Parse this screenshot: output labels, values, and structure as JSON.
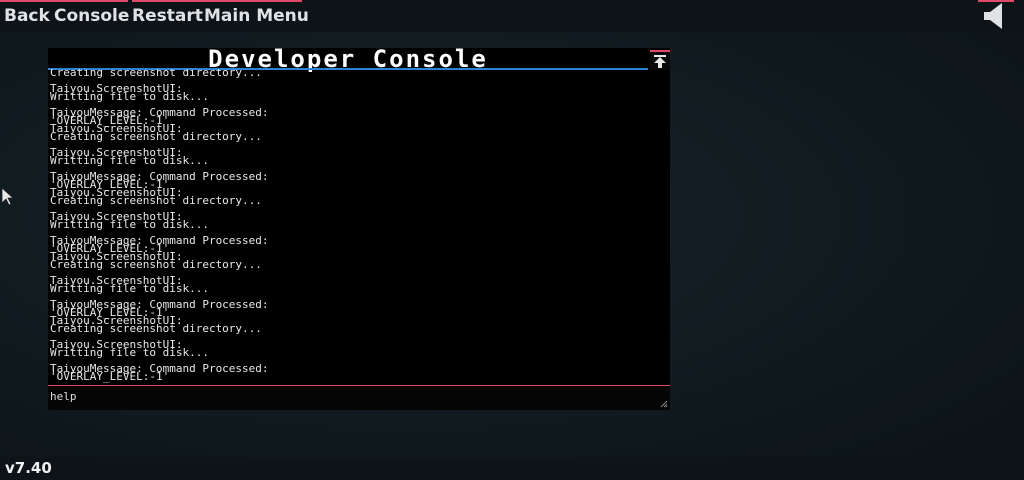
{
  "topbar": {
    "back": "Back",
    "console": "Console",
    "restart": "Restart",
    "main_menu": "Main Menu",
    "audio_icon": "speaker-icon"
  },
  "console": {
    "title": "Developer Console",
    "lines": [
      "Creating screenshot directory...",
      "",
      "Taiyou.ScreenshotUI:",
      "Writting file to disk...",
      "",
      "TaiyouMessage: Command Processed:",
      "'OVERLAY_LEVEL:-1'",
      "Taiyou.ScreenshotUI:",
      "Creating screenshot directory...",
      "",
      "Taiyou.ScreenshotUI:",
      "Writting file to disk...",
      "",
      "TaiyouMessage: Command Processed:",
      "'OVERLAY_LEVEL:-1'",
      "Taiyou.ScreenshotUI:",
      "Creating screenshot directory...",
      "",
      "Taiyou.ScreenshotUI:",
      "Writting file to disk...",
      "",
      "TaiyouMessage: Command Processed:",
      "'OVERLAY_LEVEL:-1'",
      "Taiyou.ScreenshotUI:",
      "Creating screenshot directory...",
      "",
      "Taiyou.ScreenshotUI:",
      "Writting file to disk...",
      "",
      "TaiyouMessage: Command Processed:",
      "'OVERLAY_LEVEL:-1'",
      "Taiyou.ScreenshotUI:",
      "Creating screenshot directory...",
      "",
      "Taiyou.ScreenshotUI:",
      "Writting file to disk...",
      "",
      "TaiyouMessage: Command Processed:",
      "'OVERLAY_LEVEL:-1'"
    ],
    "input_value": "help",
    "scroll_top_icon": "arrow-up-icon"
  },
  "status": {
    "version": "v7.40"
  },
  "colors": {
    "accent": "#e04a6a",
    "title_underline": "#2f83d6",
    "console_bg": "#000000",
    "text": "#e8e8e8"
  }
}
